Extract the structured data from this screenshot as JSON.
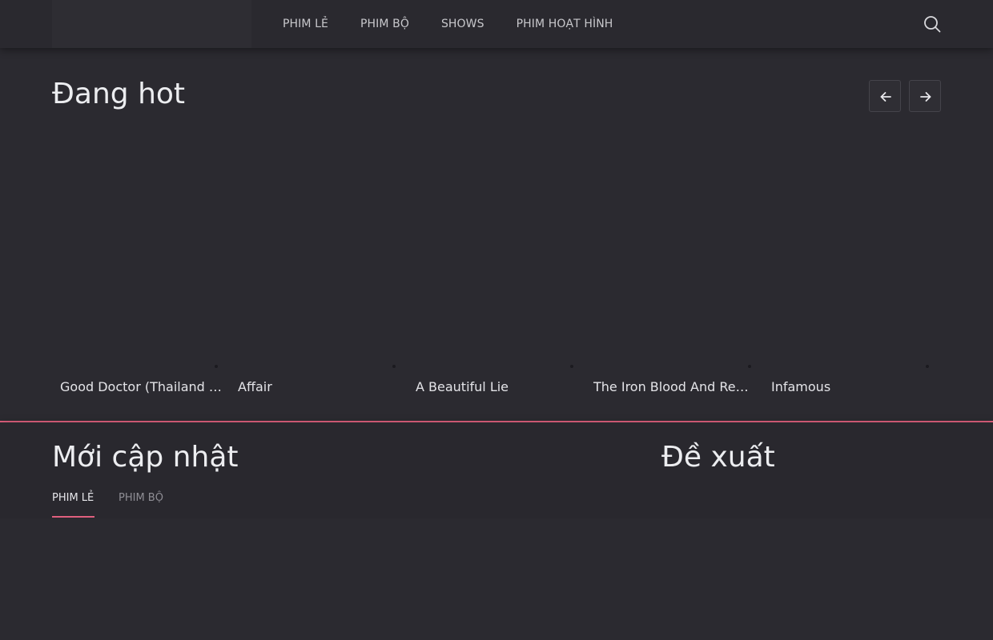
{
  "nav": {
    "items": [
      {
        "label": "PHIM LẺ"
      },
      {
        "label": "PHIM BỘ"
      },
      {
        "label": "SHOWS"
      },
      {
        "label": "PHIM HOẠT HÌNH"
      }
    ]
  },
  "hot": {
    "title": "Đang hot",
    "cards": [
      {
        "title": "Good Doctor (Thailand Version)"
      },
      {
        "title": "Affair"
      },
      {
        "title": "A Beautiful Lie"
      },
      {
        "title": "The Iron Blood And Red Heart"
      },
      {
        "title": "Infamous"
      }
    ]
  },
  "updates": {
    "title": "Mới cập nhật",
    "tabs": [
      {
        "label": "PHIM LẺ",
        "active": true
      },
      {
        "label": "PHIM BỘ",
        "active": false
      }
    ]
  },
  "suggest": {
    "title": "Đề xuất"
  },
  "theme": {
    "accent": "#e0607e",
    "background": "#2b2a30"
  },
  "icons": {
    "search": "search-icon",
    "prev": "arrow-left-icon",
    "next": "arrow-right-icon"
  }
}
